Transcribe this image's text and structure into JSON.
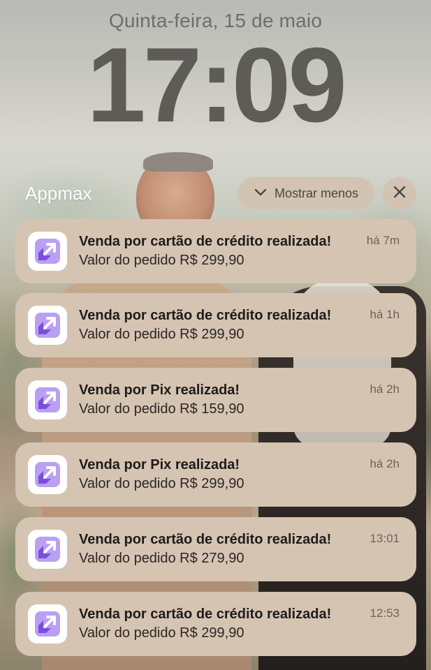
{
  "lockscreen": {
    "date": "Quinta-feira, 15 de maio",
    "time": "17:09"
  },
  "group": {
    "app_name": "Appmax",
    "show_less_label": "Mostrar menos",
    "chevron_icon": "chevron-down-icon",
    "close_icon": "close-icon"
  },
  "notifications": [
    {
      "title": "Venda por cartão de crédito realizada!",
      "body": "Valor do pedido R$ 299,90",
      "time": "há 7m"
    },
    {
      "title": "Venda por cartão de crédito realizada!",
      "body": "Valor do pedido R$ 299,90",
      "time": "há 1h"
    },
    {
      "title": "Venda por Pix realizada!",
      "body": "Valor do pedido R$ 159,90",
      "time": "há 2h"
    },
    {
      "title": "Venda por Pix realizada!",
      "body": "Valor do pedido R$ 299,90",
      "time": "há 2h"
    },
    {
      "title": "Venda por cartão de crédito realizada!",
      "body": "Valor do pedido R$ 279,90",
      "time": "13:01"
    },
    {
      "title": "Venda por cartão de crédito realizada!",
      "body": "Valor do pedido R$ 299,90",
      "time": "12:53"
    }
  ],
  "colors": {
    "notification_bg": "#d6c4b2",
    "app_icon_accent": "#8b5cf6",
    "app_icon_accent_light": "#b9a0f3"
  }
}
